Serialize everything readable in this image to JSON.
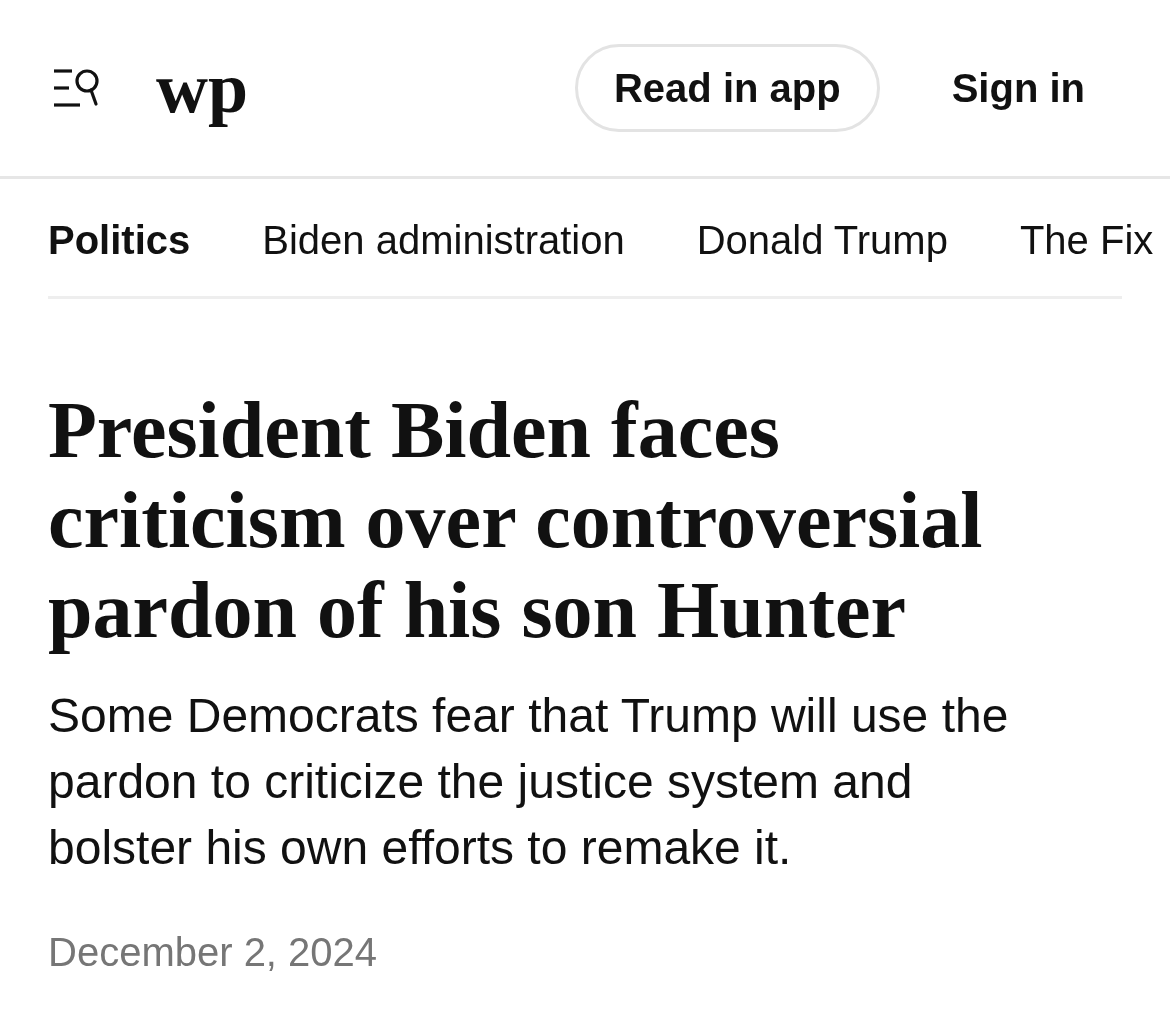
{
  "header": {
    "logo": "wp",
    "buttons": [
      {
        "label": "Read in app",
        "kind": "outlined"
      },
      {
        "label": "Sign in",
        "kind": "plain"
      }
    ]
  },
  "section_nav": {
    "items": [
      {
        "label": "Politics",
        "selected": true
      },
      {
        "label": "Biden administration",
        "selected": false
      },
      {
        "label": "Donald Trump",
        "selected": false
      },
      {
        "label": "The Fix",
        "selected": false
      }
    ]
  },
  "article": {
    "headline": "President Biden faces criticism over controversial pardon of his son Hunter",
    "dek": "Some Democrats fear that Trump will use the pardon to criticize the justice system and bolster his own efforts to remake it.",
    "date": "December 2, 2024"
  }
}
